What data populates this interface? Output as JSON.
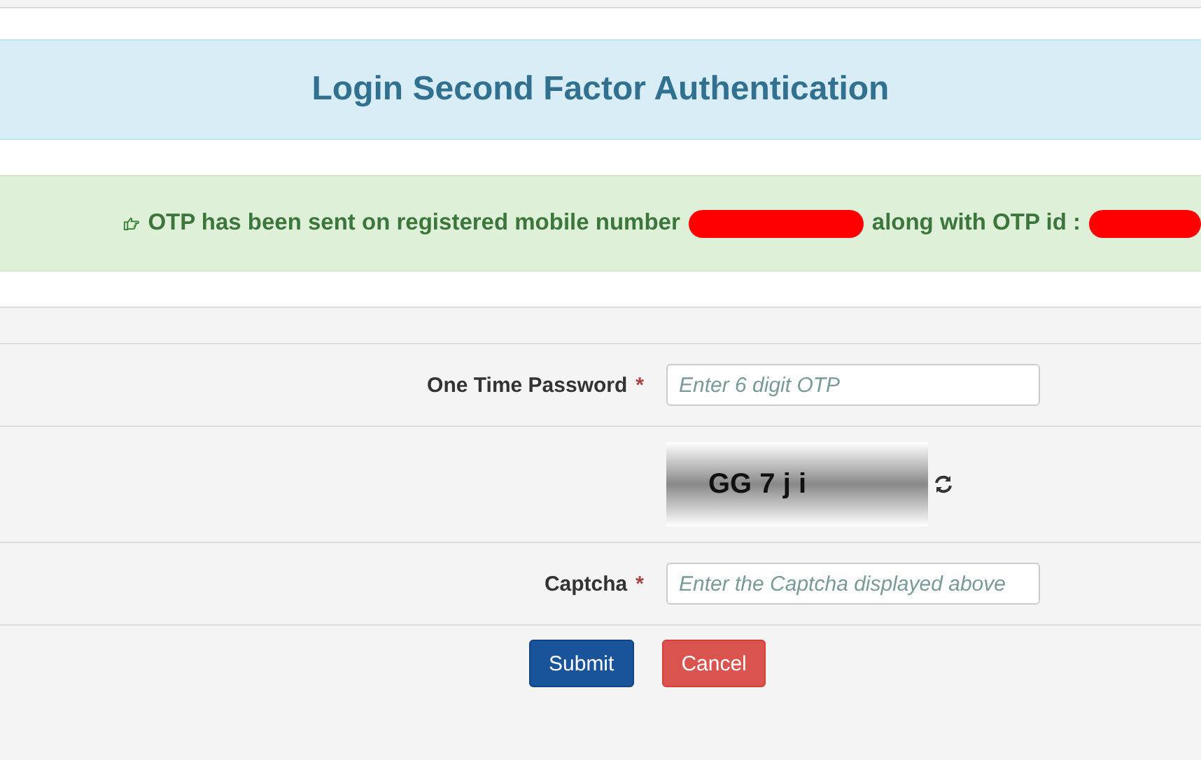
{
  "heading": {
    "title": "Login Second Factor Authentication"
  },
  "alert": {
    "message": "OTP has been sent on registered mobile number",
    "suffix": "along with OTP id :",
    "redacted": true
  },
  "form": {
    "rows": [
      {
        "kind": "input",
        "label": "One Time Password",
        "required": "*",
        "placeholder": "Enter 6 digit OTP"
      },
      {
        "kind": "captcha",
        "text": "GG 7 j i"
      },
      {
        "kind": "input",
        "label": "Captcha",
        "required": "*",
        "placeholder": "Enter the Captcha displayed above"
      }
    ]
  },
  "buttons": [
    {
      "label": "Submit",
      "kind": "primary"
    },
    {
      "label": "Cancel",
      "kind": "danger"
    }
  ]
}
